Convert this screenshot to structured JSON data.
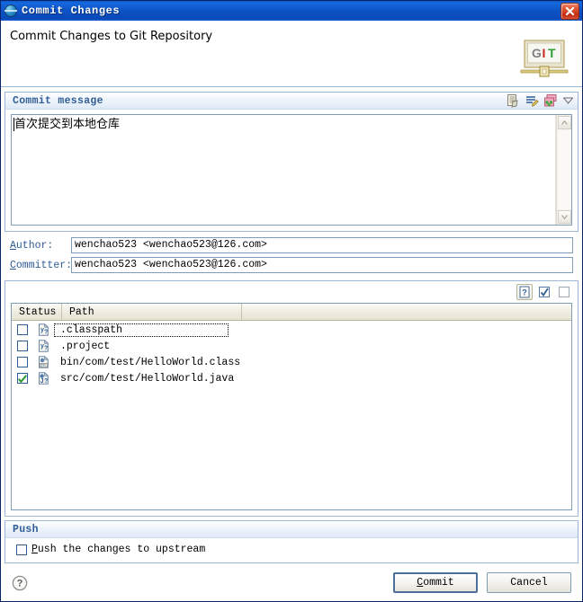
{
  "window": {
    "title": "Commit Changes",
    "icon": "eclipse-globe-icon",
    "close_label": "✕",
    "accent": "#0a4ab8"
  },
  "header": {
    "title": "Commit Changes to Git Repository",
    "logo_text_g": "G",
    "logo_text_i": "I",
    "logo_text_t": "T",
    "logo_name": "git-logo"
  },
  "commit_message": {
    "section_title": "Commit message",
    "value": "首次提交到本地仓库",
    "placeholder": "",
    "tools": [
      {
        "name": "commit-message-template-icon",
        "title": "Add Signed-off-by"
      },
      {
        "name": "sign-commit-icon",
        "title": "Add Change-Id"
      },
      {
        "name": "amend-commit-icon",
        "title": "Amend previous commit"
      },
      {
        "name": "chevron-down-icon",
        "title": "More"
      }
    ],
    "scrollbar": {
      "up": "▲",
      "down": "▼"
    }
  },
  "author": {
    "label_prefix": "",
    "label_mnemonic": "A",
    "label_rest": "uthor:",
    "value": "wenchao523 <wenchao523@126.com>"
  },
  "committer": {
    "label_mnemonic": "C",
    "label_rest": "ommitter:",
    "value": "wenchao523 <wenchao523@126.com>"
  },
  "files": {
    "toolbar": [
      {
        "name": "show-untracked-files-button",
        "glyph": "?",
        "pressed": true
      },
      {
        "name": "select-all-button",
        "glyph": "✔",
        "pressed": false
      },
      {
        "name": "deselect-all-button",
        "glyph": "",
        "pressed": false
      }
    ],
    "columns": [
      "Status",
      "Path"
    ],
    "rows": [
      {
        "checked": false,
        "status_icon": "untracked-file-icon",
        "path": ".classpath",
        "focused": true
      },
      {
        "checked": false,
        "status_icon": "untracked-file-icon",
        "path": ".project",
        "focused": false
      },
      {
        "checked": false,
        "status_icon": "untracked-class-file-icon",
        "path": "bin/com/test/HelloWorld.class",
        "focused": false
      },
      {
        "checked": true,
        "status_icon": "untracked-java-file-icon",
        "path": "src/com/test/HelloWorld.java",
        "focused": false
      }
    ]
  },
  "push": {
    "section_title": "Push",
    "checkbox_checked": false,
    "label_mnemonic": "P",
    "label_rest": "ush the changes to upstream"
  },
  "footer": {
    "help_name": "help-icon",
    "commit_mnemonic": "C",
    "commit_rest": "ommit",
    "cancel_label": "Cancel"
  }
}
